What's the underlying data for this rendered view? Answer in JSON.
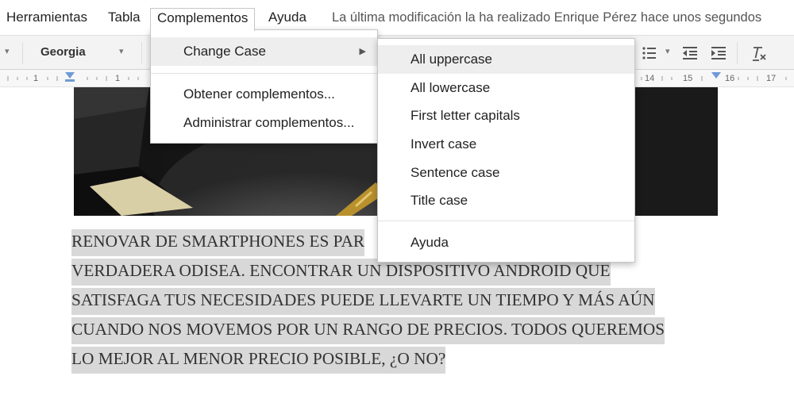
{
  "menubar": {
    "items": [
      "Herramientas",
      "Tabla",
      "Complementos",
      "Ayuda"
    ],
    "last_modified": "La última modificación la ha realizado Enrique Pérez hace unos segundos"
  },
  "toolbar": {
    "font": "Georgia",
    "icons": [
      "bulleted-list-icon",
      "chevron-down-icon",
      "decrease-indent-icon",
      "increase-indent-icon",
      "clear-formatting-icon"
    ]
  },
  "ruler": {
    "left_labels": [
      "1",
      "1"
    ],
    "right_labels": [
      "14",
      "15",
      "16",
      "17"
    ]
  },
  "complementos_menu": {
    "items": [
      "Change Case",
      "Obtener complementos...",
      "Administrar complementos..."
    ],
    "submenu_arrow": "▶"
  },
  "change_case_menu": {
    "items": [
      "All uppercase",
      "All lowercase",
      "First letter capitals",
      "Invert case",
      "Sentence case",
      "Title case"
    ],
    "help": "Ayuda"
  },
  "document": {
    "lines": [
      "RENOVAR DE SMARTPHONES ES PAR",
      "VERDADERA ODISEA. ENCONTRAR UN DISPOSITIVO ANDROID QUE",
      "SATISFAGA TUS NECESIDADES PUEDE LLEVARTE UN TIEMPO Y MÁS AÚN",
      "CUANDO NOS MOVEMOS POR UN RANGO DE PRECIOS. TODOS QUEREMOS",
      "LO MEJOR AL MENOR PRECIO POSIBLE, ¿O NO?"
    ]
  },
  "colors": {
    "selection": "#d8d8d8",
    "menu_highlight": "#eeeeee",
    "ruler_marker": "#6e9bd6"
  }
}
